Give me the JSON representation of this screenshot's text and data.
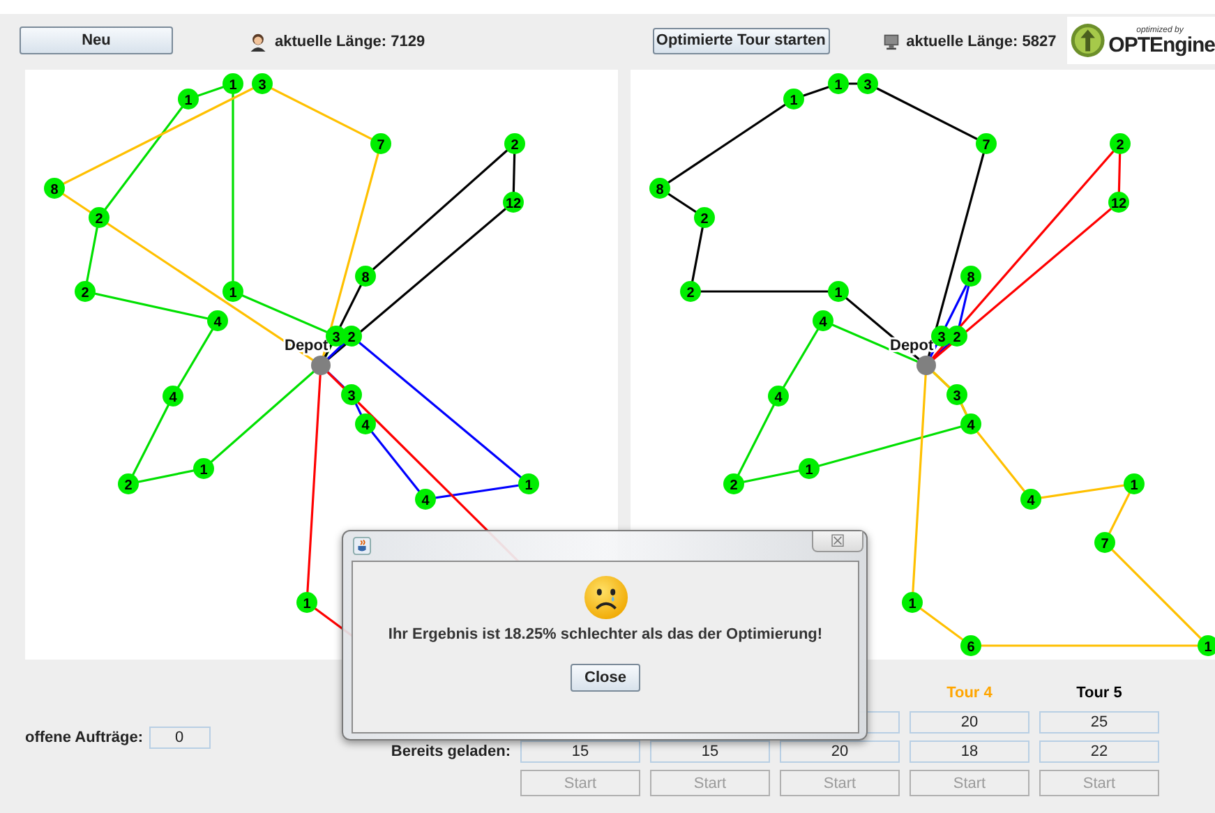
{
  "toolbar": {
    "new_button": "Neu",
    "user_length": "aktuelle Länge: 7129",
    "optimize_button": "Optimierte Tour starten",
    "optimizer_length": "aktuelle Länge: 5827",
    "logo": {
      "caption": "optimized by",
      "name": "OPTEngine"
    }
  },
  "maps": [
    {
      "depot": "Depot",
      "nodes": [
        {
          "label": "1"
        },
        {
          "label": "1"
        },
        {
          "label": "3"
        },
        {
          "label": "7"
        },
        {
          "label": "8"
        },
        {
          "label": "2"
        },
        {
          "label": "2"
        },
        {
          "label": "1"
        },
        {
          "label": "4"
        },
        {
          "label": "4"
        },
        {
          "label": "2"
        },
        {
          "label": "1"
        },
        {
          "label": "3"
        },
        {
          "label": "2"
        },
        {
          "label": "8"
        },
        {
          "label": "2"
        },
        {
          "label": "12"
        },
        {
          "label": "3"
        },
        {
          "label": "4"
        },
        {
          "label": "4"
        },
        {
          "label": "1"
        },
        {
          "label": "1"
        }
      ],
      "tours": [
        {
          "color": "#00e000"
        },
        {
          "color": "#ffc000"
        },
        {
          "color": "#000000"
        },
        {
          "color": "#0000ff"
        },
        {
          "color": "#ff0000"
        }
      ]
    },
    {
      "depot": "Depot",
      "nodes": [
        {
          "label": "1"
        },
        {
          "label": "1"
        },
        {
          "label": "3"
        },
        {
          "label": "7"
        },
        {
          "label": "8"
        },
        {
          "label": "2"
        },
        {
          "label": "2"
        },
        {
          "label": "1"
        },
        {
          "label": "4"
        },
        {
          "label": "4"
        },
        {
          "label": "2"
        },
        {
          "label": "1"
        },
        {
          "label": "3"
        },
        {
          "label": "2"
        },
        {
          "label": "8"
        },
        {
          "label": "2"
        },
        {
          "label": "12"
        },
        {
          "label": "3"
        },
        {
          "label": "4"
        },
        {
          "label": "4"
        },
        {
          "label": "1"
        },
        {
          "label": "1"
        },
        {
          "label": "7"
        },
        {
          "label": "6"
        },
        {
          "label": "1"
        }
      ],
      "tours": [
        {
          "color": "#000000"
        },
        {
          "color": "#00e000"
        },
        {
          "color": "#0000ff"
        },
        {
          "color": "#ff0000"
        },
        {
          "color": "#ffc000"
        }
      ]
    }
  ],
  "orders": {
    "label": "offene Aufträge:",
    "value": "0"
  },
  "tour_table": {
    "loaded_label": "Bereits geladen:",
    "columns": [
      {
        "loaded": "15",
        "start": {
          "label": "Start",
          "disabled": true
        }
      },
      {
        "loaded": "15",
        "start": {
          "label": "Start",
          "disabled": true
        }
      },
      {
        "loaded": "20",
        "start": {
          "label": "Start",
          "disabled": true
        }
      },
      {
        "header": "Tour 4",
        "color": "#ffa500",
        "capacity": "20",
        "loaded": "18",
        "start": {
          "label": "Start",
          "disabled": true
        }
      },
      {
        "header": "Tour 5",
        "color": "#000000",
        "capacity": "25",
        "loaded": "22",
        "start": {
          "label": "Start",
          "disabled": true
        }
      }
    ]
  },
  "dialog": {
    "message": "Ihr Ergebnis ist 18.25% schlechter als das der Optimierung!",
    "close_button": "Close",
    "close_glyph": "☒"
  }
}
